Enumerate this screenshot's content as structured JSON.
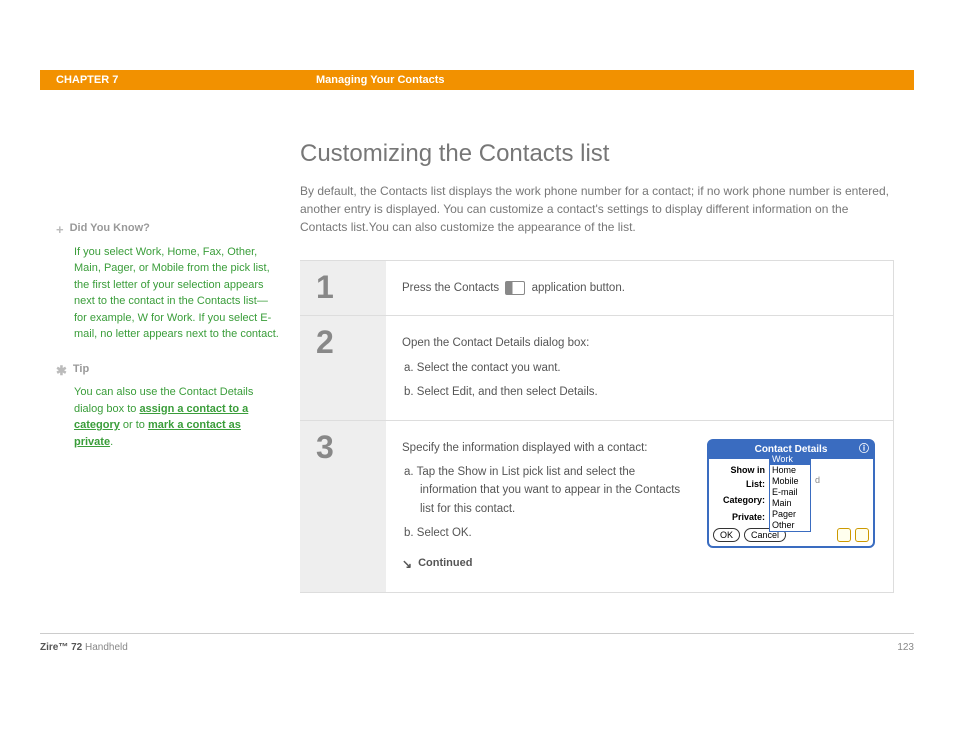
{
  "header": {
    "chapter": "CHAPTER 7",
    "section": "Managing Your Contacts"
  },
  "main": {
    "title": "Customizing the Contacts list",
    "intro": "By default, the Contacts list displays the work phone number for a contact; if no work phone number is entered, another entry is displayed. You can customize a contact's settings to display different information on the Contacts list.You can also customize the appearance of the list."
  },
  "sidebar": {
    "didyouknow": {
      "label": "Did You Know?",
      "text": "If you select Work, Home, Fax, Other, Main, Pager, or Mobile from the pick list, the first letter of your selection appears next to the contact in the Contacts list—for example, W for Work. If you select E-mail, no letter appears next to the contact."
    },
    "tip": {
      "label": "Tip",
      "prefix": "You can also use the Contact Details dialog box to ",
      "link1": "assign a contact to a category",
      "mid": " or to ",
      "link2": "mark a contact as private",
      "suffix": "."
    }
  },
  "steps": [
    {
      "num": "1",
      "line1a": "Press the Contacts ",
      "line1b": " application button."
    },
    {
      "num": "2",
      "line1": "Open the Contact Details dialog box:",
      "sub_a": "a.  Select the contact you want.",
      "sub_b": "b.  Select Edit, and then select Details."
    },
    {
      "num": "3",
      "line1": "Specify the information displayed with a contact:",
      "sub_a": "a.  Tap the Show in List pick list and select the information that you want to appear in the Contacts list for this contact.",
      "sub_b": "b.  Select OK.",
      "continued": "Continued"
    }
  ],
  "device": {
    "title": "Contact Details",
    "labels": {
      "show": "Show in List:",
      "category": "Category:",
      "private": "Private:"
    },
    "options": [
      "Work",
      "Home",
      "Mobile",
      "E-mail",
      "Main",
      "Pager",
      "Other"
    ],
    "category_value": "d",
    "buttons": {
      "ok": "OK",
      "cancel": "Cancel"
    }
  },
  "footer": {
    "product_bold": "Zire™ 72",
    "product_rest": " Handheld",
    "page": "123"
  }
}
